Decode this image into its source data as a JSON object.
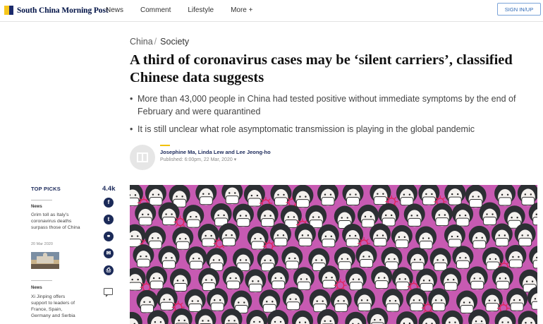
{
  "header": {
    "logo_text": "South China Morning Post",
    "nav": [
      "News",
      "Comment",
      "Lifestyle",
      "More +"
    ],
    "signin_label": "SIGN IN/UP"
  },
  "article": {
    "breadcrumb_section": "China",
    "breadcrumb_sep": "/",
    "breadcrumb_subsection": "Society",
    "headline": "A third of coronavirus cases may be ‘silent carriers’, classified Chinese data suggests",
    "bullets": [
      "More than 43,000 people in China had tested positive without immediate symptoms by the end of February and were quarantined",
      "It is still unclear what role asymptomatic transmission is playing in the global pandemic"
    ],
    "authors": "Josephine Ma, Linda Lew and Lee Jeong-ho",
    "published": "Published: 6:00pm, 22 Mar, 2020"
  },
  "top_picks": {
    "title": "TOP PICKS",
    "items": [
      {
        "category": "News",
        "headline": "Grim toll as Italy’s coronavirus deaths surpass those of China",
        "date": "20 Mar 2020"
      },
      {
        "category": "News",
        "headline": "Xi Jinping offers support to leaders of France, Spain, Germany and Serbia"
      }
    ]
  },
  "share": {
    "count": "4.4k",
    "icons": [
      "facebook-icon",
      "twitter-icon",
      "link-icon",
      "email-icon",
      "print-icon",
      "comment-icon"
    ]
  },
  "colors": {
    "brand_navy": "#1d2b5c",
    "brand_yellow": "#f2c200",
    "hero_pink": "#c75ab2"
  }
}
